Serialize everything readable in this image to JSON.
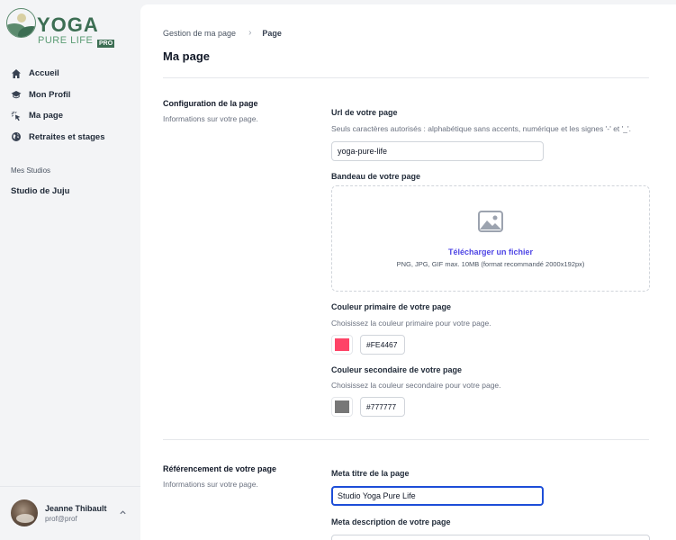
{
  "brand": {
    "name": "YOGA",
    "tagline": "PURE LIFE",
    "badge": "PRO",
    "color": "#3c6e53"
  },
  "sidebar": {
    "items": [
      {
        "label": "Accueil",
        "icon": "home-icon"
      },
      {
        "label": "Mon Profil",
        "icon": "graduation-cap-icon"
      },
      {
        "label": "Ma page",
        "icon": "cursor-click-icon"
      },
      {
        "label": "Retraites et stages",
        "icon": "globe-icon"
      }
    ],
    "section_label": "Mes Studios",
    "studios": [
      "Studio de Juju"
    ]
  },
  "user": {
    "name": "Jeanne Thibault",
    "email": "prof@prof"
  },
  "breadcrumb": {
    "parent": "Gestion de ma page",
    "current": "Page"
  },
  "page_title": "Ma page",
  "config": {
    "title": "Configuration de la page",
    "description": "Informations sur votre page.",
    "url_label": "Url de votre page",
    "url_help": "Seuls caractères autorisés : alphabétique sans accents, numérique et les signes '-' et '_'.",
    "url_value": "yoga-pure-life",
    "banner_label": "Bandeau de votre page",
    "upload_link": "Télécharger un fichier",
    "upload_hint": "PNG, JPG, GIF max. 10MB (format recommandé 2000x192px)",
    "primary_label": "Couleur primaire de votre page",
    "primary_help": "Choisissez la couleur primaire pour votre page.",
    "primary_color": "#FE4467",
    "secondary_label": "Couleur secondaire de votre page",
    "secondary_help": "Choisissez la couleur secondaire pour votre page.",
    "secondary_color": "#777777"
  },
  "seo": {
    "title": "Référencement de votre page",
    "description": "Informations sur votre page.",
    "meta_title_label": "Meta titre de la page",
    "meta_title_value": "Studio Yoga Pure Life",
    "meta_desc_label": "Meta description de votre page"
  }
}
